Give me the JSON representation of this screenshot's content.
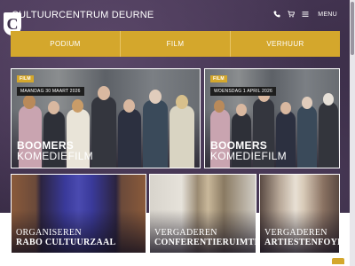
{
  "header": {
    "site_title": "CULTUURCENTRUM DEURNE",
    "logo_letter": "C",
    "menu_label": "MENU",
    "icons": [
      "phone-icon",
      "cart-icon",
      "menu-icon"
    ]
  },
  "nav": {
    "items": [
      {
        "label": "PODIUM"
      },
      {
        "label": "FILM"
      },
      {
        "label": "VERHUUR"
      }
    ]
  },
  "events": [
    {
      "tag": "FILM",
      "date": "MAANDAG 30 MAART 2026",
      "title_line1": "BOOMERS",
      "title_line2": "KOMEDIEFILM"
    },
    {
      "tag": "FILM",
      "date": "WOENSDAG 1 APRIL 2026",
      "title_line1": "BOOMERS",
      "title_line2": "KOMEDIEFILM"
    }
  ],
  "venues": [
    {
      "line1": "ORGANISEREN",
      "line2": "RABO CULTUURZAAL"
    },
    {
      "line1": "VERGADEREN",
      "line2": "CONFERENTIERUIMTE"
    },
    {
      "line1": "VERGADEREN",
      "line2": "ARTIESTENFOYER"
    }
  ],
  "colors": {
    "accent": "#d4a72c",
    "background": "#3c2f4a",
    "date_badge": "#1e1e1e"
  }
}
